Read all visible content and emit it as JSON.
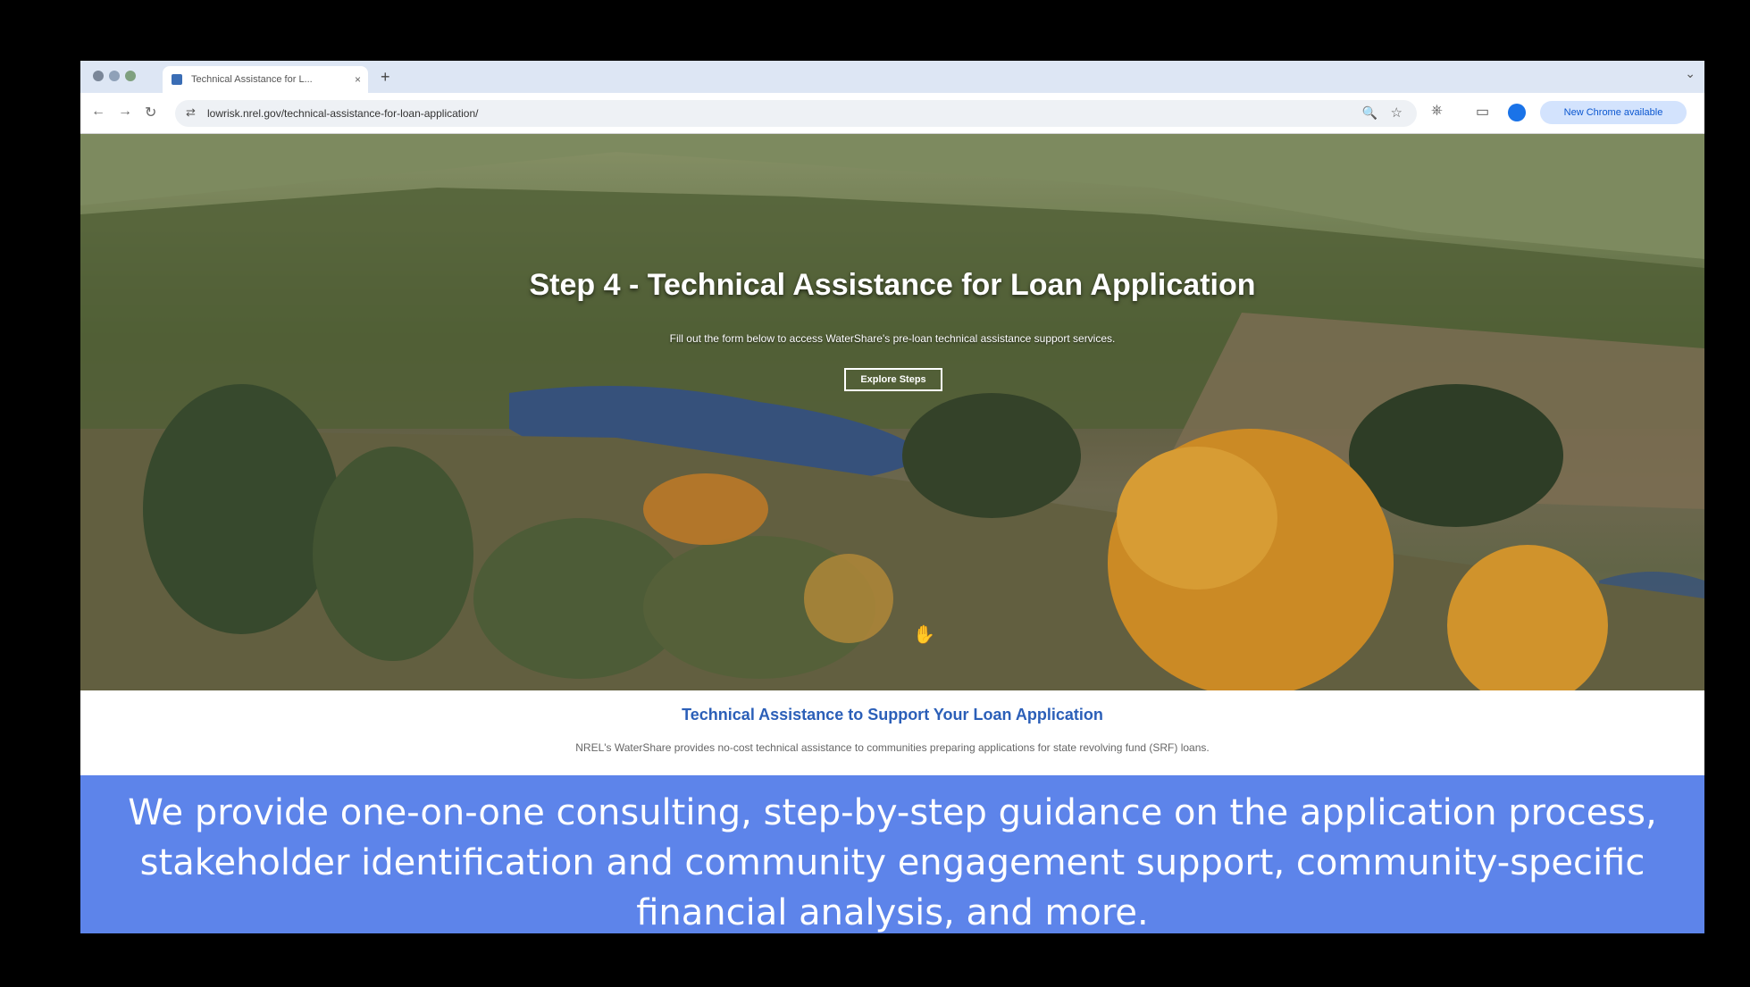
{
  "browser": {
    "tab_title": "Technical Assistance for L...",
    "tab_close": "×",
    "new_tab": "+",
    "url": "lowrisk.nrel.gov/technical-assistance-for-loan-application/",
    "update_label": "New Chrome available"
  },
  "icons": {
    "back": "←",
    "forward": "→",
    "reload": "↻",
    "site_info": "⇄",
    "zoom": "🔍",
    "star": "☆",
    "extensions": "⎈",
    "side_panel": "▭",
    "cursor": "✋",
    "tabstrip_chevron": "⌄"
  },
  "hero": {
    "title": "Step 4 - Technical Assistance for Loan Application",
    "subtitle": "Fill out the form below to access WaterShare's pre-loan technical assistance support services.",
    "button_label": "Explore Steps"
  },
  "section": {
    "heading": "Technical Assistance to Support Your Loan Application",
    "body": "NREL's WaterShare provides no-cost technical assistance to communities preparing applications for state revolving fund (SRF) loans."
  },
  "caption": {
    "text": "We provide one-on-one consulting, step-by-step guidance on the application process, stakeholder identification and community engagement support, community-specific financial analysis, and more."
  },
  "colors": {
    "caption_bg": "#5d84ea",
    "heading": "#2b5fb8",
    "foliage_orange": "#e39a2a"
  }
}
